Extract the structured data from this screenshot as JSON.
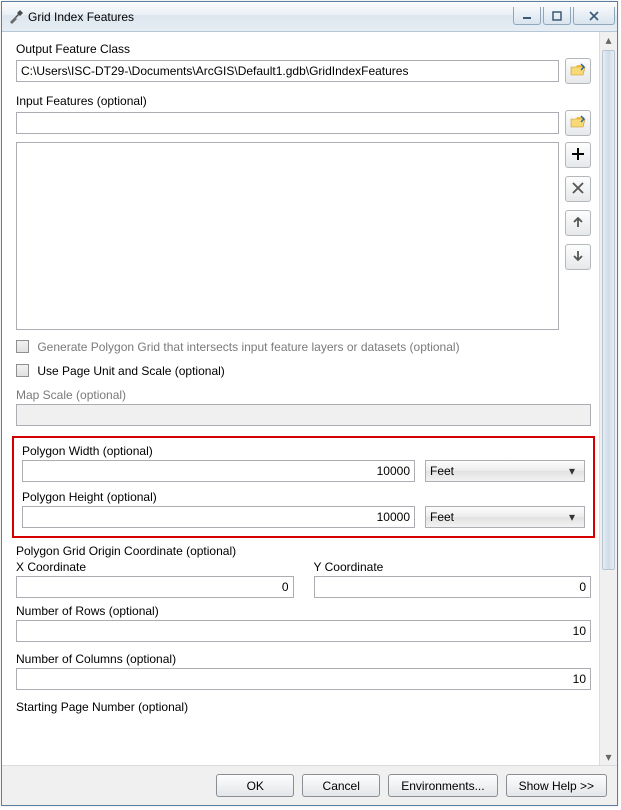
{
  "window": {
    "title": "Grid Index Features"
  },
  "fields": {
    "output_label": "Output Feature Class",
    "output_value": "C:\\Users\\ISC-DT29-\\Documents\\ArcGIS\\Default1.gdb\\GridIndexFeatures",
    "input_label": "Input Features (optional)",
    "input_value": "",
    "generate_label": "Generate Polygon Grid that intersects input feature layers or datasets (optional)",
    "use_page_label": "Use Page Unit and Scale (optional)",
    "map_scale_label": "Map Scale (optional)",
    "map_scale_value": "",
    "poly_width_label": "Polygon Width (optional)",
    "poly_width_value": "10000",
    "poly_width_unit": "Feet",
    "poly_height_label": "Polygon Height (optional)",
    "poly_height_value": "10000",
    "poly_height_unit": "Feet",
    "origin_label": "Polygon Grid Origin Coordinate (optional)",
    "x_label": "X Coordinate",
    "x_value": "0",
    "y_label": "Y Coordinate",
    "y_value": "0",
    "rows_label": "Number of Rows (optional)",
    "rows_value": "10",
    "cols_label": "Number of Columns (optional)",
    "cols_value": "10",
    "startpage_label": "Starting Page Number (optional)"
  },
  "buttons": {
    "ok": "OK",
    "cancel": "Cancel",
    "env": "Environments...",
    "help": "Show Help >>"
  }
}
